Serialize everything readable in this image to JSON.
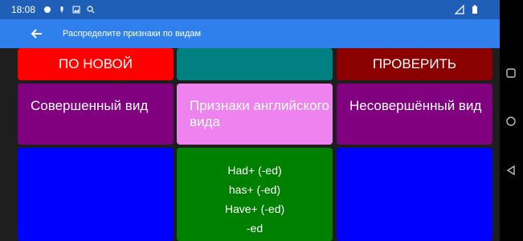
{
  "status_bar": {
    "time": "18:08"
  },
  "app_bar": {
    "title": "Распределите признаки по видам",
    "back_icon": "arrow-left-icon"
  },
  "buttons": {
    "reset_label": "ПО НОВОЙ",
    "check_label": "ПРОВЕРИТЬ"
  },
  "columns": {
    "perfect": "Совершенный вид",
    "english_signs": "Признаки английского вида",
    "imperfect": "Несовершённый вид"
  },
  "signs": {
    "items": [
      "Had+ (-ed)",
      "has+ (-ed)",
      "Have+ (-ed)",
      "-ed"
    ]
  },
  "colors": {
    "status_bar": "#1f5fb8",
    "app_bar": "#2f80ed",
    "reset": "#ff0000",
    "teal": "#008080",
    "check": "#8b0000",
    "perfect_header": "#800080",
    "signs_header": "#ee82ee",
    "imperfect_header": "#800080",
    "blue": "#0000ff",
    "green": "#008000"
  }
}
